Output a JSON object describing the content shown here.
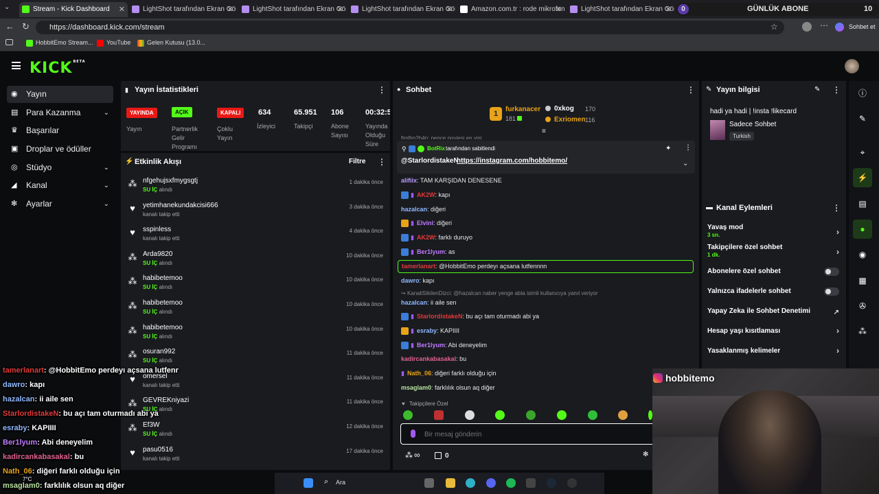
{
  "browser": {
    "tabs": [
      {
        "title": "Stream - Kick Dashboard",
        "active": true
      },
      {
        "title": "LightShot tarafından Ekran Görüntü"
      },
      {
        "title": "LightShot tarafından Ekran Görüntü"
      },
      {
        "title": "LightShot tarafından Ekran Görüntü"
      },
      {
        "title": "Amazon.com.tr : rode mikrofon stu"
      },
      {
        "title": "LightShot tarafından Ekran Görüntü"
      }
    ],
    "sub_counter": {
      "left": "0",
      "label": "GÜNLÜK ABONE",
      "right": "10"
    },
    "url": "https://dashboard.kick.com/stream",
    "sohbet_et": "Sohbet et",
    "bookmarks": [
      "HobbitEmo Stream...",
      "YouTube",
      "Gelen Kutusu (13.0..."
    ]
  },
  "app": {
    "logo": "KICK",
    "logo_beta": "BETA"
  },
  "sidebar": {
    "items": [
      {
        "label": "Yayın",
        "icon": "broadcast-icon",
        "active": true
      },
      {
        "label": "Para Kazanma",
        "icon": "money-icon",
        "chev": true
      },
      {
        "label": "Başarılar",
        "icon": "trophy-icon"
      },
      {
        "label": "Droplar ve ödüller",
        "icon": "gift-icon"
      },
      {
        "label": "Stüdyo",
        "icon": "studio-icon",
        "chev": true
      },
      {
        "label": "Kanal",
        "icon": "channel-icon",
        "chev": true
      },
      {
        "label": "Ayarlar",
        "icon": "gear-icon",
        "chev": true
      }
    ]
  },
  "stats": {
    "title": "Yayın İstatistikleri",
    "badges": [
      {
        "badge": "YAYINDA",
        "label": "Yayın",
        "color": "#e91916"
      },
      {
        "badge": "AÇIK",
        "label": "Partnerlik Gelir Programı",
        "color": "#53fc18"
      },
      {
        "badge": "KAPALI",
        "label": "Çoklu Yayın",
        "color": "#e91916"
      }
    ],
    "values": [
      {
        "value": "634",
        "label": "İzleyici"
      },
      {
        "value": "65.951",
        "label": "Takipçi"
      },
      {
        "value": "106",
        "label": "Abone Sayısı"
      },
      {
        "value": "00:32:5",
        "label": "Yayında Olduğu Süre"
      }
    ]
  },
  "activity": {
    "title": "Etkinlik Akışı",
    "filter": "Filtre",
    "items": [
      {
        "name": "nfgehujsxfmygsgtj",
        "sub_em": "SU İÇ",
        "sub": " alındı",
        "time": "1 dakika önce",
        "icon": "people-icon"
      },
      {
        "name": "yetimhanekundakcisi666",
        "sub": "kanalı takip etti",
        "time": "3 dakika önce",
        "icon": "heart-icon"
      },
      {
        "name": "sspinless",
        "sub": "kanalı takip etti",
        "time": "4 dakika önce",
        "icon": "heart-icon"
      },
      {
        "name": "Arda9820",
        "sub_em": "SU İÇ",
        "sub": " alındı",
        "time": "10 dakika önce",
        "icon": "people-icon"
      },
      {
        "name": "habibetemoo",
        "sub_em": "SU İÇ",
        "sub": " alındı",
        "time": "10 dakika önce",
        "icon": "people-icon"
      },
      {
        "name": "habibetemoo",
        "sub_em": "SU İÇ",
        "sub": " alındı",
        "time": "10 dakika önce",
        "icon": "people-icon"
      },
      {
        "name": "habibetemoo",
        "sub_em": "SU İÇ",
        "sub": " alındı",
        "time": "10 dakika önce",
        "icon": "people-icon"
      },
      {
        "name": "osuran992",
        "sub_em": "SU İÇ",
        "sub": " alındı",
        "time": "11 dakika önce",
        "icon": "people-icon"
      },
      {
        "name": "omersel",
        "sub": "kanalı takip etti",
        "time": "11 dakika önce",
        "icon": "heart-icon"
      },
      {
        "name": "GEVREKniyazi",
        "sub_em": "SU İÇ",
        "sub": " alındı",
        "time": "11 dakika önce",
        "icon": "people-icon"
      },
      {
        "name": "Ef3W",
        "sub_em": "SU İÇ",
        "sub": " alındı",
        "time": "12 dakika önce",
        "icon": "people-icon"
      },
      {
        "name": "pasu0516",
        "sub": "kanalı takip etti",
        "time": "17 dakika önce",
        "icon": "heart-icon"
      }
    ]
  },
  "chat": {
    "title": "Sohbet",
    "leaderboard": [
      {
        "rank": "1",
        "name": "furkanacer",
        "count": "181"
      },
      {
        "name": "0xkog",
        "count": "170"
      },
      {
        "name": "Exriomen",
        "count": "116"
      }
    ],
    "cut_line": "fimfim2b4p: pence poyiesi en yisi",
    "pinned_by": "BotRix",
    "pinned_suffix": "tarafından sabitlendi",
    "pinned_user": "@StarlordistakeN",
    "pinned_link": "https://instagram.com/hobbitemo/",
    "messages": [
      {
        "user": "alifiix",
        "color": "#b99cff",
        "text": "TAM KARŞIDAN DENESENE"
      },
      {
        "user": "AK2W",
        "color": "#e03a3a",
        "text": "kapı",
        "badges": [
          "#3b7dd8"
        ],
        "mic": true
      },
      {
        "user": "hazalcan",
        "color": "#8fb8ff",
        "text": "diğeri"
      },
      {
        "user": "Elvini",
        "color": "#c07aff",
        "text": "diğeri",
        "badges": [
          "#e8a317"
        ],
        "mic": true
      },
      {
        "user": "AK2W",
        "color": "#e03a3a",
        "text": "farklı duruyo",
        "badges": [
          "#3b7dd8"
        ],
        "mic": true
      },
      {
        "user": "Ber1lyum",
        "color": "#c07aff",
        "text": "as",
        "badges": [
          "#3b7dd8"
        ],
        "mic": true
      },
      {
        "user": "tamerlanart",
        "color": "#e03a3a",
        "text": "@HobbitEmo perdeyı açsana lutfennnn",
        "highlight": true
      },
      {
        "user": "dawro",
        "color": "#8fb8ff",
        "text": "kapı"
      },
      {
        "reply": "KanaliSikilenDizci: @hazalcan naber yenge abla isimli kullanıcıya yanıt veriyor"
      },
      {
        "user": "hazalcan",
        "color": "#8fb8ff",
        "text": "ii aile sen"
      },
      {
        "user": "StarlordistakeN",
        "color": "#e03a3a",
        "text": "bu açı tam oturmadı abi ya",
        "badges": [
          "#3b7dd8"
        ],
        "mic": true
      },
      {
        "user": "esraby",
        "color": "#8fb8ff",
        "text": "KAPIIII",
        "badges": [
          "#e8a317"
        ],
        "mic": true
      },
      {
        "user": "Ber1lyum",
        "color": "#c07aff",
        "text": "Abi deneyelim",
        "badges": [
          "#3b7dd8"
        ],
        "mic": true
      },
      {
        "user": "kadircankabasakal",
        "color": "#e06090",
        "text": "bu"
      },
      {
        "user": "Nath_06",
        "color": "#e8a317",
        "text": "diğeri farklı olduğu için",
        "mic": true
      },
      {
        "user": "msaglam0",
        "color": "#b8e0a0",
        "text": "farklılık olsun aq diğer"
      }
    ],
    "followers_only": "Takipçilere Özel",
    "placeholder": "Bir mesaj gönderin",
    "points": "0"
  },
  "info": {
    "title": "Yayın bilgisi",
    "stream_title": "hadi ya hadi | !insta !likecard",
    "category": "Sadece Sohbet",
    "language": "Turkish"
  },
  "channel_actions": {
    "title": "Kanal Eylemleri",
    "items": [
      {
        "label": "Yavaş mod",
        "sub": "3 sn.",
        "control": "chevron"
      },
      {
        "label": "Takipçilere özel sohbet",
        "sub": "1 dk.",
        "control": "chevron"
      },
      {
        "label": "Abonelere özel sohbet",
        "control": "toggle"
      },
      {
        "label": "Yalnızca ifadelerle sohbet",
        "control": "toggle"
      },
      {
        "label": "Yapay Zeka ile Sohbet Denetimi",
        "control": "external"
      },
      {
        "label": "Hesap yaşı kısıtlaması",
        "control": "chevron"
      },
      {
        "label": "Yasaklanmış kelimeler",
        "control": "chevron"
      }
    ]
  },
  "overlay": {
    "instagram": "hobbitemo",
    "chat": [
      {
        "user": "tamerlanart",
        "color": "#e03a3a",
        "text": "@HobbitEmo perdeyı açsana lutfenr"
      },
      {
        "user": "dawro",
        "color": "#8fb8ff",
        "text": "kapı"
      },
      {
        "user": "hazalcan",
        "color": "#8fb8ff",
        "text": "ii aile sen"
      },
      {
        "user": "StarlordistakeN",
        "color": "#e03a3a",
        "text": "bu açı tam oturmadı abi ya"
      },
      {
        "user": "esraby",
        "color": "#8fb8ff",
        "text": "KAPIIII"
      },
      {
        "user": "Ber1lyum",
        "color": "#c07aff",
        "text": "Abi deneyelim"
      },
      {
        "user": "kadircankabasakal",
        "color": "#e06090",
        "text": "bu"
      },
      {
        "user": "Nath_06",
        "color": "#e8a317",
        "text": "diğeri farklı olduğu için"
      },
      {
        "user": "msaglam0",
        "color": "#b8e0a0",
        "text": "farklılık olsun aq diğer"
      }
    ]
  },
  "taskbar": {
    "search": "Ara",
    "weather": "7°C"
  },
  "colors": {
    "accent": "#53fc18",
    "panel": "#191b1f",
    "bg": "#0b0c0e"
  }
}
